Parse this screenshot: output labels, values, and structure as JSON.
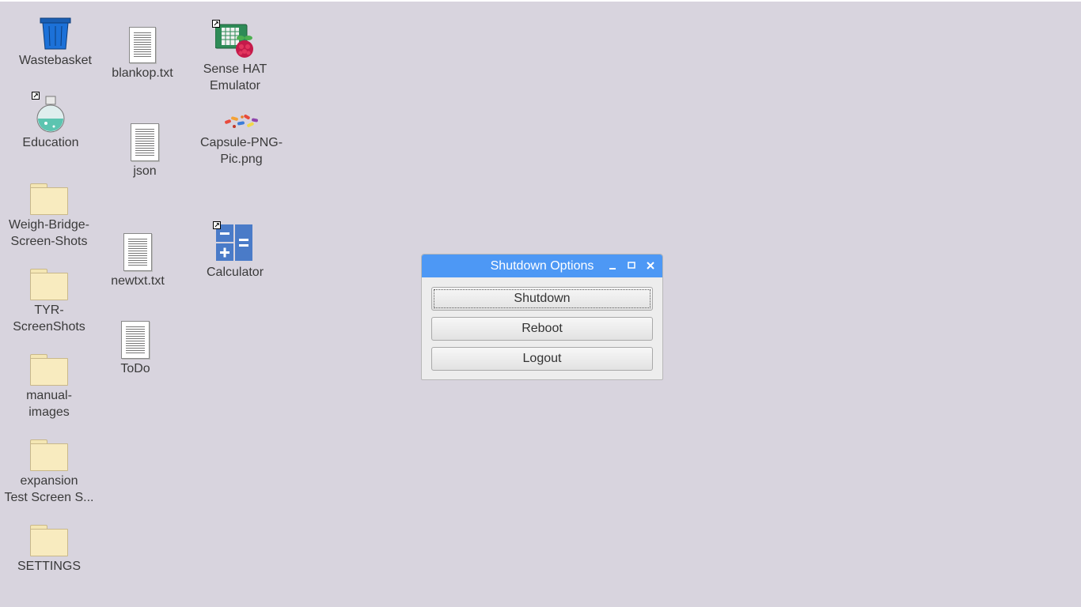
{
  "desktop": {
    "icons": {
      "wastebasket": "Wastebasket",
      "blankop": "blankop.txt",
      "sense_hat": "Sense HAT\nEmulator",
      "education": "Education",
      "json": "json",
      "capsule": "Capsule-PNG-\nPic.png",
      "weigh_bridge": "Weigh-Bridge-\nScreen-Shots",
      "newtxt": "newtxt.txt",
      "calculator": "Calculator",
      "tyr": "TYR-\nScreenShots",
      "todo": "ToDo",
      "manual_images": "manual-\nimages",
      "expansion": "expansion\nTest Screen S...",
      "settings": "SETTINGS"
    }
  },
  "dialog": {
    "title": "Shutdown Options",
    "buttons": {
      "shutdown": "Shutdown",
      "reboot": "Reboot",
      "logout": "Logout"
    }
  },
  "colors": {
    "desktop_bg": "#d8d4de",
    "titlebar": "#4d98f5"
  }
}
